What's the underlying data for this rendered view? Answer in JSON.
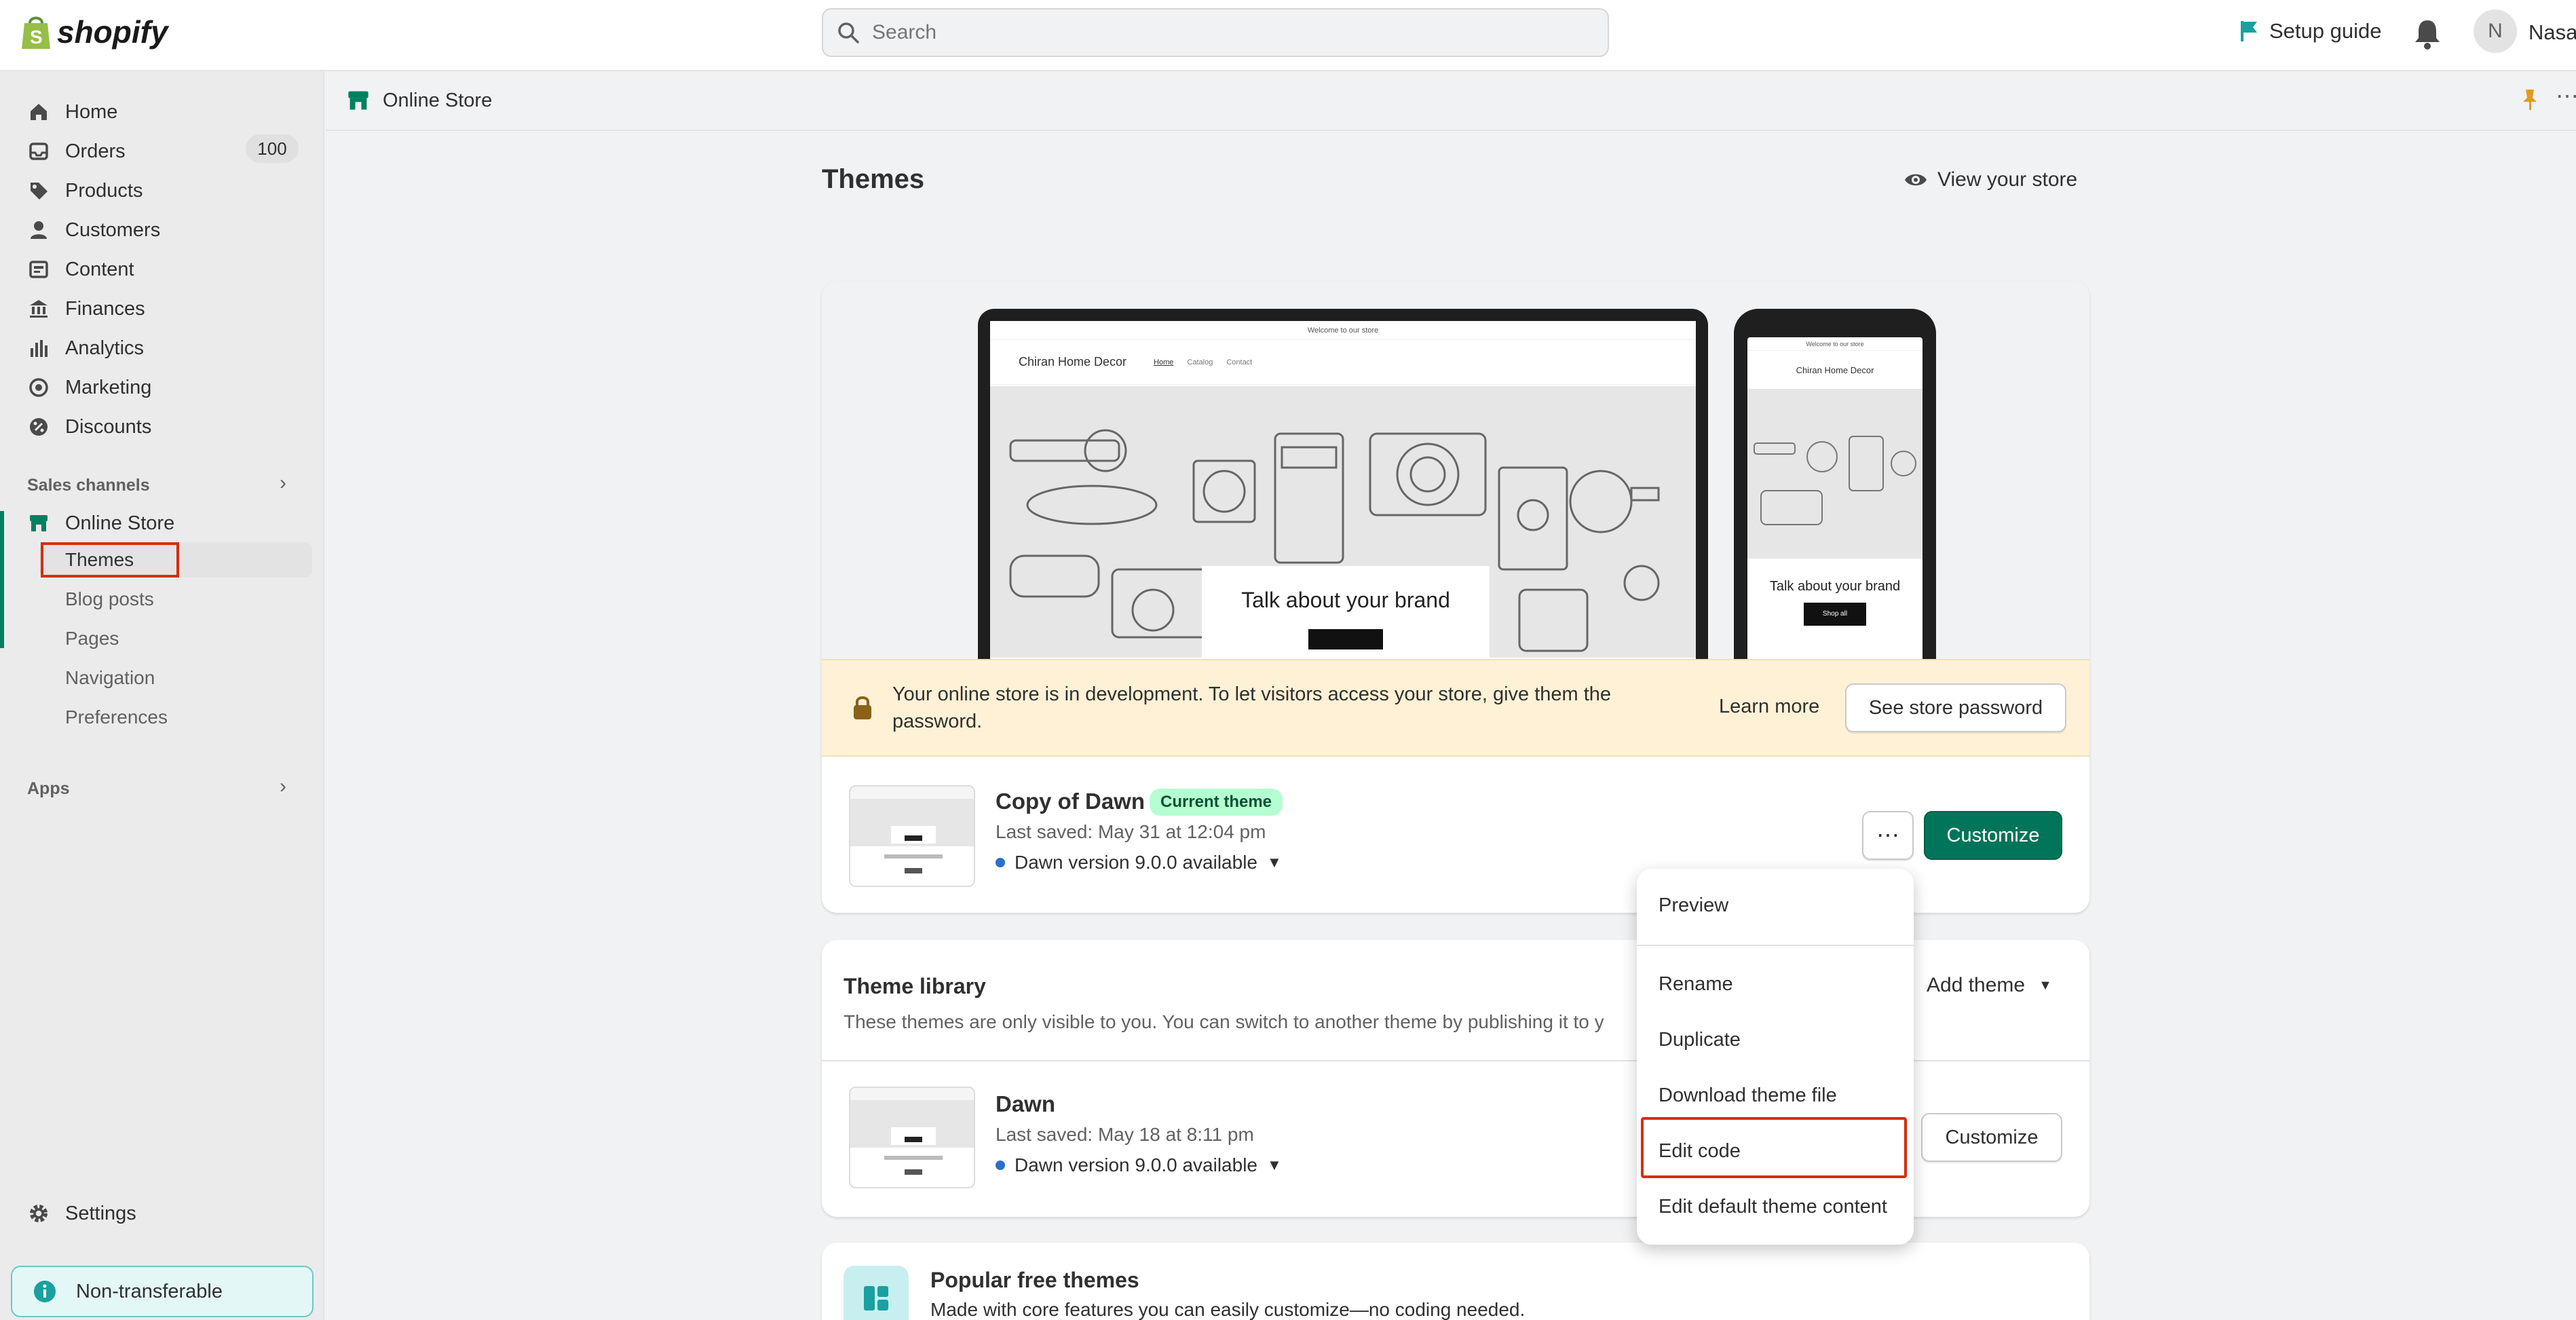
{
  "app": {
    "logo_text": "shopify"
  },
  "topbar": {
    "search_placeholder": "Search",
    "setup_guide": "Setup guide",
    "avatar_initial": "N",
    "user_name": "Nasa"
  },
  "sidebar": {
    "items": [
      {
        "label": "Home",
        "icon": "home-icon"
      },
      {
        "label": "Orders",
        "icon": "orders-icon",
        "badge": "100"
      },
      {
        "label": "Products",
        "icon": "tag-icon"
      },
      {
        "label": "Customers",
        "icon": "person-icon"
      },
      {
        "label": "Content",
        "icon": "content-icon"
      },
      {
        "label": "Finances",
        "icon": "bank-icon"
      },
      {
        "label": "Analytics",
        "icon": "bar-chart-icon"
      },
      {
        "label": "Marketing",
        "icon": "target-icon"
      },
      {
        "label": "Discounts",
        "icon": "discount-icon"
      }
    ],
    "sales_channels_label": "Sales channels",
    "online_store_label": "Online Store",
    "online_store_sub": [
      "Themes",
      "Blog posts",
      "Pages",
      "Navigation",
      "Preferences"
    ],
    "apps_label": "Apps",
    "settings_label": "Settings",
    "non_transferable": "Non-transferable"
  },
  "subheader": {
    "title": "Online Store"
  },
  "page": {
    "title": "Themes",
    "view_store": "View your store"
  },
  "preview": {
    "announcement": "Welcome to our store",
    "store_name": "Chiran Home Decor",
    "nav": [
      "Home",
      "Catalog",
      "Contact"
    ],
    "hero_text": "Talk about your brand",
    "phone_store_name": "Chiran Home Decor",
    "phone_hero_text": "Talk about your brand",
    "phone_button": "Shop all"
  },
  "banner": {
    "text": "Your online store is in development. To let visitors access your store, give them the password.",
    "learn_more": "Learn more",
    "see_password": "See store password"
  },
  "current_theme": {
    "name": "Copy of Dawn",
    "badge": "Current theme",
    "last_saved": "Last saved: May 31 at 12:04 pm",
    "version": "Dawn version 9.0.0 available",
    "customize": "Customize"
  },
  "menu": {
    "items": [
      "Preview",
      "Rename",
      "Duplicate",
      "Download theme file",
      "Edit code",
      "Edit default theme content"
    ]
  },
  "library": {
    "title": "Theme library",
    "description": "These themes are only visible to you. You can switch to another theme by publishing it to y",
    "add_theme": "Add theme",
    "theme": {
      "name": "Dawn",
      "last_saved": "Last saved: May 18 at 8:11 pm",
      "version": "Dawn version 9.0.0 available",
      "customize": "Customize"
    }
  },
  "popular": {
    "title": "Popular free themes",
    "description": "Made with core features you can easily customize—no coding needed."
  },
  "colors": {
    "primary": "#00755a",
    "highlight": "#d72c0d",
    "banner": "#fff1d6"
  }
}
